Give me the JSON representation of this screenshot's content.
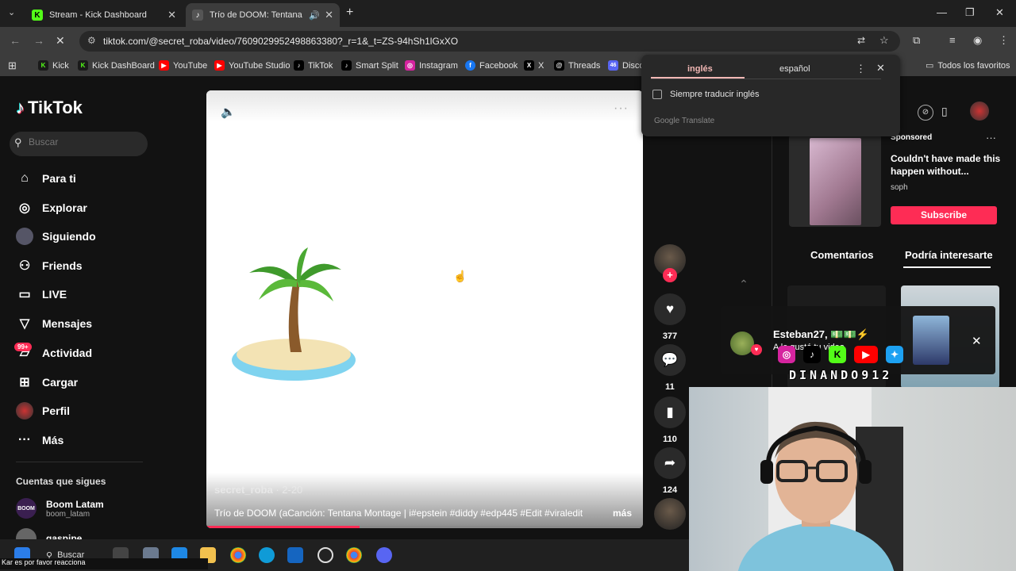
{
  "tabs": [
    {
      "title": "Stream - Kick Dashboard",
      "favicon": "K",
      "favicon_color": "#53fc18"
    },
    {
      "title": "Trío de DOOM: Tentana Mo",
      "favicon": "♪",
      "favicon_color": "#222222"
    }
  ],
  "address": {
    "url": "tiktok.com/@secret_roba/video/7609029952498863380?_r=1&_t=ZS-94hSh1lGxXO"
  },
  "bookmarks": [
    {
      "label": "Kick",
      "icon": "K",
      "color": "#53fc18"
    },
    {
      "label": "Kick DashBoard",
      "icon": "K",
      "color": "#53fc18"
    },
    {
      "label": "YouTube",
      "icon": "▶",
      "color": "#ff0000"
    },
    {
      "label": "YouTube Studio",
      "icon": "▶",
      "color": "#ff0000"
    },
    {
      "label": "TikTok",
      "icon": "♪",
      "color": "#000000"
    },
    {
      "label": "Smart Split",
      "icon": "♪",
      "color": "#000000"
    },
    {
      "label": "Instagram",
      "icon": "◎",
      "color": "#d6249f"
    },
    {
      "label": "Facebook",
      "icon": "f",
      "color": "#1877f2"
    },
    {
      "label": "X",
      "icon": "X",
      "color": "#000000"
    },
    {
      "label": "Threads",
      "icon": "@",
      "color": "#000000"
    },
    {
      "label": "Disco",
      "icon": "46",
      "color": "#5865f2"
    }
  ],
  "all_bookmarks": "Todos los favoritos",
  "translate": {
    "lang_from": "inglés",
    "lang_to": "español",
    "always_translate": "Siempre traducir inglés",
    "provider": "Google Translate"
  },
  "tiktok": {
    "logo": "TikTok",
    "search_placeholder": "Buscar",
    "nav": [
      {
        "label": "Para ti",
        "icon": "⌂"
      },
      {
        "label": "Explorar",
        "icon": "◎"
      },
      {
        "label": "Siguiendo",
        "icon": "avatar"
      },
      {
        "label": "Friends",
        "icon": "⚇"
      },
      {
        "label": "LIVE",
        "icon": "▭"
      },
      {
        "label": "Mensajes",
        "icon": "▽"
      },
      {
        "label": "Actividad",
        "icon": "▱"
      },
      {
        "label": "Cargar",
        "icon": "⊞"
      },
      {
        "label": "Perfil",
        "icon": "avatar"
      },
      {
        "label": "Más",
        "icon": "···"
      }
    ],
    "activity_badge": "99+",
    "following_heading": "Cuentas que sigues",
    "following": [
      {
        "name": "Boom Latam",
        "handle": "boom_latam",
        "avatar_text": "BOOM"
      },
      {
        "name": "gaspipe",
        "handle": "",
        "avatar_text": ""
      }
    ]
  },
  "video": {
    "author": "secret_roba",
    "date": " · 2-20",
    "caption": "Trío de DOOM (aCanción: Tentana Montage | i#epstein #diddy #edp445 #Edit #viraledit",
    "more": "más",
    "progress": 0.35
  },
  "actions": {
    "likes": "377",
    "comments": "11",
    "saves": "110",
    "shares": "124"
  },
  "sponsored": {
    "label": "Sponsored",
    "title": "Couldn't have made this happen without...",
    "user": "soph",
    "button": "Subscribe"
  },
  "right_tabs": {
    "comments": "Comentarios",
    "suggestions": "Podría interesarte"
  },
  "notification": {
    "name": "Esteban27, 💵💵⚡",
    "message": "A le gustó tu video"
  },
  "overlay_text": "DINANDO912",
  "taskbar": {
    "search": "Buscar",
    "ticker": "Kar es por favor reacciona"
  },
  "colors": {
    "tiktok_red": "#fe2c55",
    "kick_green": "#53fc18",
    "translate_accent": "#f2b8b5"
  }
}
